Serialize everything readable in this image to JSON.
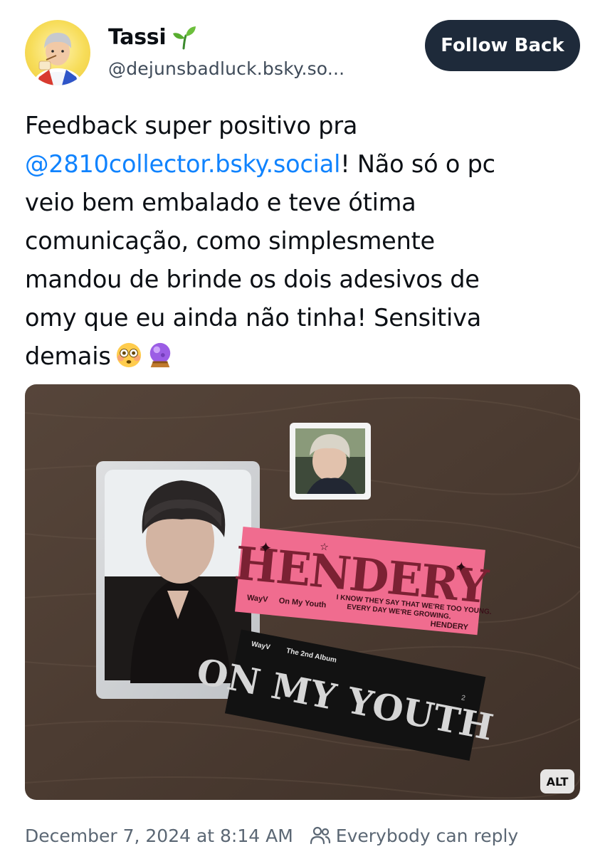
{
  "author": {
    "display_name": "Tassi",
    "name_emoji_icon": "seedling-icon",
    "handle": "@dejunsbadluck.bsky.so...",
    "avatar_icon": "user-avatar"
  },
  "follow_button": {
    "label": "Follow Back",
    "color": "#1e2a3a"
  },
  "post": {
    "line1": "Feedback super positivo pra",
    "mention": "@2810collector.bsky.social",
    "line2_rest": "! Não só o pc",
    "line3": "veio bem embalado e teve ótima",
    "line4": "comunicação, como simplesmente",
    "line5": "mandou de brinde os dois adesivos de",
    "line6": "omy que eu ainda não tinha! Sensitiva",
    "line7": "demais",
    "emojis": [
      "flushed-face-icon",
      "crystal-ball-icon"
    ],
    "mention_color": "#1083fe"
  },
  "image": {
    "alt_label": "ALT",
    "pink_sticker": {
      "title": "HENDERY",
      "brand": "WayV",
      "album": "On My Youth",
      "lyric_line1": "I KNOW THEY SAY THAT WE'RE TOO YOUNG.",
      "lyric_line2": "EVERY DAY WE'RE GROWING.",
      "name": "HENDERY"
    },
    "black_sticker": {
      "brand": "WayV",
      "subtitle": "The 2nd Album",
      "title": "ON MY YOUTH",
      "mark": "2"
    }
  },
  "footer": {
    "timestamp": "December 7, 2024 at 8:14 AM",
    "reply_icon": "people-icon",
    "reply_setting": "Everybody can reply"
  }
}
